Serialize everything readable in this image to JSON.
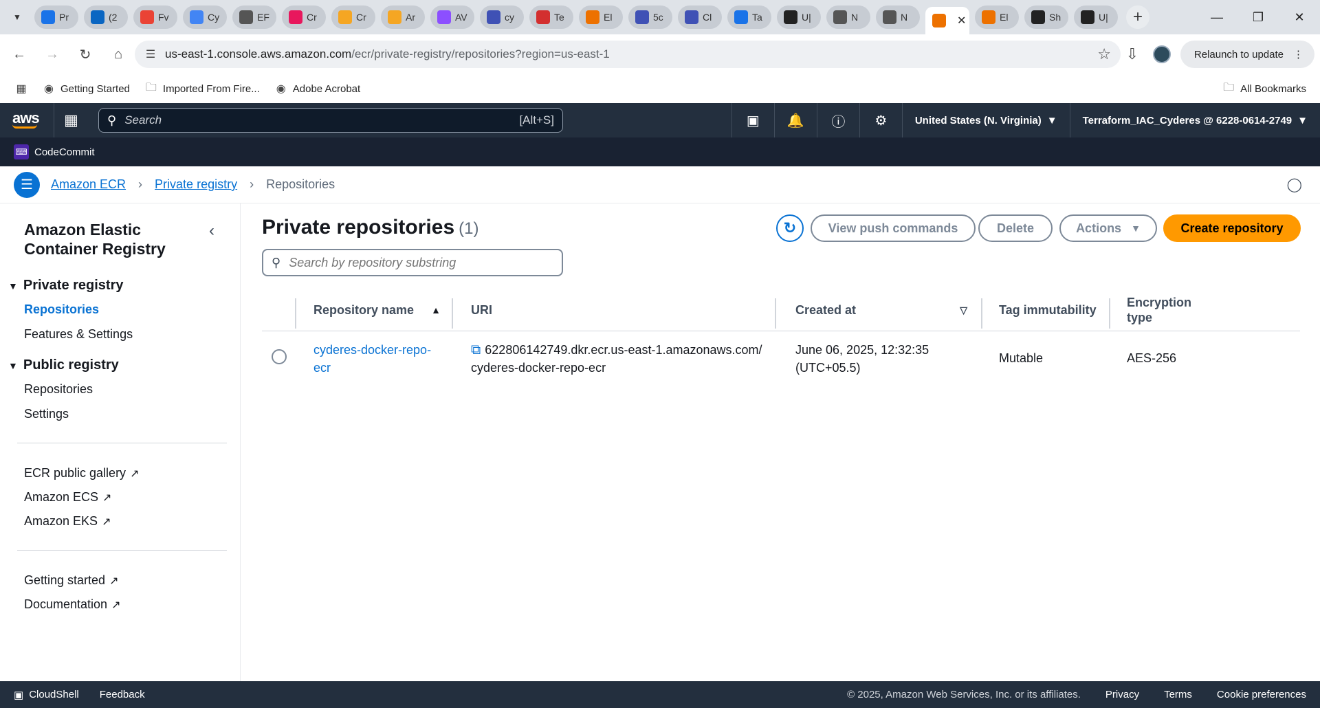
{
  "browser": {
    "tabs": [
      {
        "label": "Pr",
        "color": "#1a73e8"
      },
      {
        "label": "(2",
        "color": "#0a66c2"
      },
      {
        "label": "Fv",
        "color": "#ea4335"
      },
      {
        "label": "Cy",
        "color": "#4285f4"
      },
      {
        "label": "EF",
        "color": "#555555"
      },
      {
        "label": "Cr",
        "color": "#e8175d"
      },
      {
        "label": "Cr",
        "color": "#f5a623"
      },
      {
        "label": "Ar",
        "color": "#f5a623"
      },
      {
        "label": "AV",
        "color": "#8c4fff"
      },
      {
        "label": "cy",
        "color": "#3f51b5"
      },
      {
        "label": "Te",
        "color": "#d32f2f"
      },
      {
        "label": "El",
        "color": "#ed7100"
      },
      {
        "label": "5c",
        "color": "#3f51b5"
      },
      {
        "label": "Cl",
        "color": "#3f51b5"
      },
      {
        "label": "Ta",
        "color": "#1a73e8"
      },
      {
        "label": "U|",
        "color": "#222222"
      },
      {
        "label": "N",
        "color": "#555555"
      },
      {
        "label": "N",
        "color": "#555555"
      },
      {
        "label": "",
        "color": "#ed7100",
        "active": true
      },
      {
        "label": "El",
        "color": "#ed7100"
      },
      {
        "label": "Sh",
        "color": "#222222"
      },
      {
        "label": "U|",
        "color": "#222222"
      }
    ],
    "url_host": "us-east-1.console.aws.amazon.com",
    "url_path": "/ecr/private-registry/repositories?region=us-east-1",
    "relaunch_label": "Relaunch to update",
    "bookmarks": [
      "Getting Started",
      "Imported From Fire...",
      "Adobe Acrobat"
    ],
    "all_bookmarks": "All Bookmarks"
  },
  "aws": {
    "logo": "aws",
    "search_placeholder": "Search",
    "search_shortcut": "[Alt+S]",
    "region": "United States (N. Virginia)",
    "account": "Terraform_IAC_Cyderes @ 6228-0614-2749",
    "service_shortcut": "CodeCommit"
  },
  "breadcrumb": {
    "items": [
      "Amazon ECR",
      "Private registry"
    ],
    "current": "Repositories"
  },
  "sidebar": {
    "title": "Amazon Elastic Container Registry",
    "private_heading": "Private registry",
    "private_items": [
      "Repositories",
      "Features & Settings"
    ],
    "public_heading": "Public registry",
    "public_items": [
      "Repositories",
      "Settings"
    ],
    "external_links": [
      "ECR public gallery",
      "Amazon ECS",
      "Amazon EKS"
    ],
    "help_links": [
      "Getting started",
      "Documentation"
    ]
  },
  "main": {
    "title": "Private repositories",
    "count": "(1)",
    "buttons": {
      "push": "View push commands",
      "delete": "Delete",
      "actions": "Actions",
      "create": "Create repository"
    },
    "search_placeholder": "Search by repository substring",
    "columns": [
      "Repository name",
      "URI",
      "Created at",
      "Tag immutability",
      "Encryption type"
    ],
    "rows": [
      {
        "name": "cyderes-docker-repo-ecr",
        "uri": "622806142749.dkr.ecr.us-east-1.amazonaws.com/cyderes-docker-repo-ecr",
        "created": "June 06, 2025, 12:32:35 (UTC+05.5)",
        "tag_immutability": "Mutable",
        "encryption": "AES-256"
      }
    ]
  },
  "footer": {
    "cloudshell": "CloudShell",
    "feedback": "Feedback",
    "copyright": "© 2025, Amazon Web Services, Inc. or its affiliates.",
    "links": [
      "Privacy",
      "Terms",
      "Cookie preferences"
    ]
  }
}
